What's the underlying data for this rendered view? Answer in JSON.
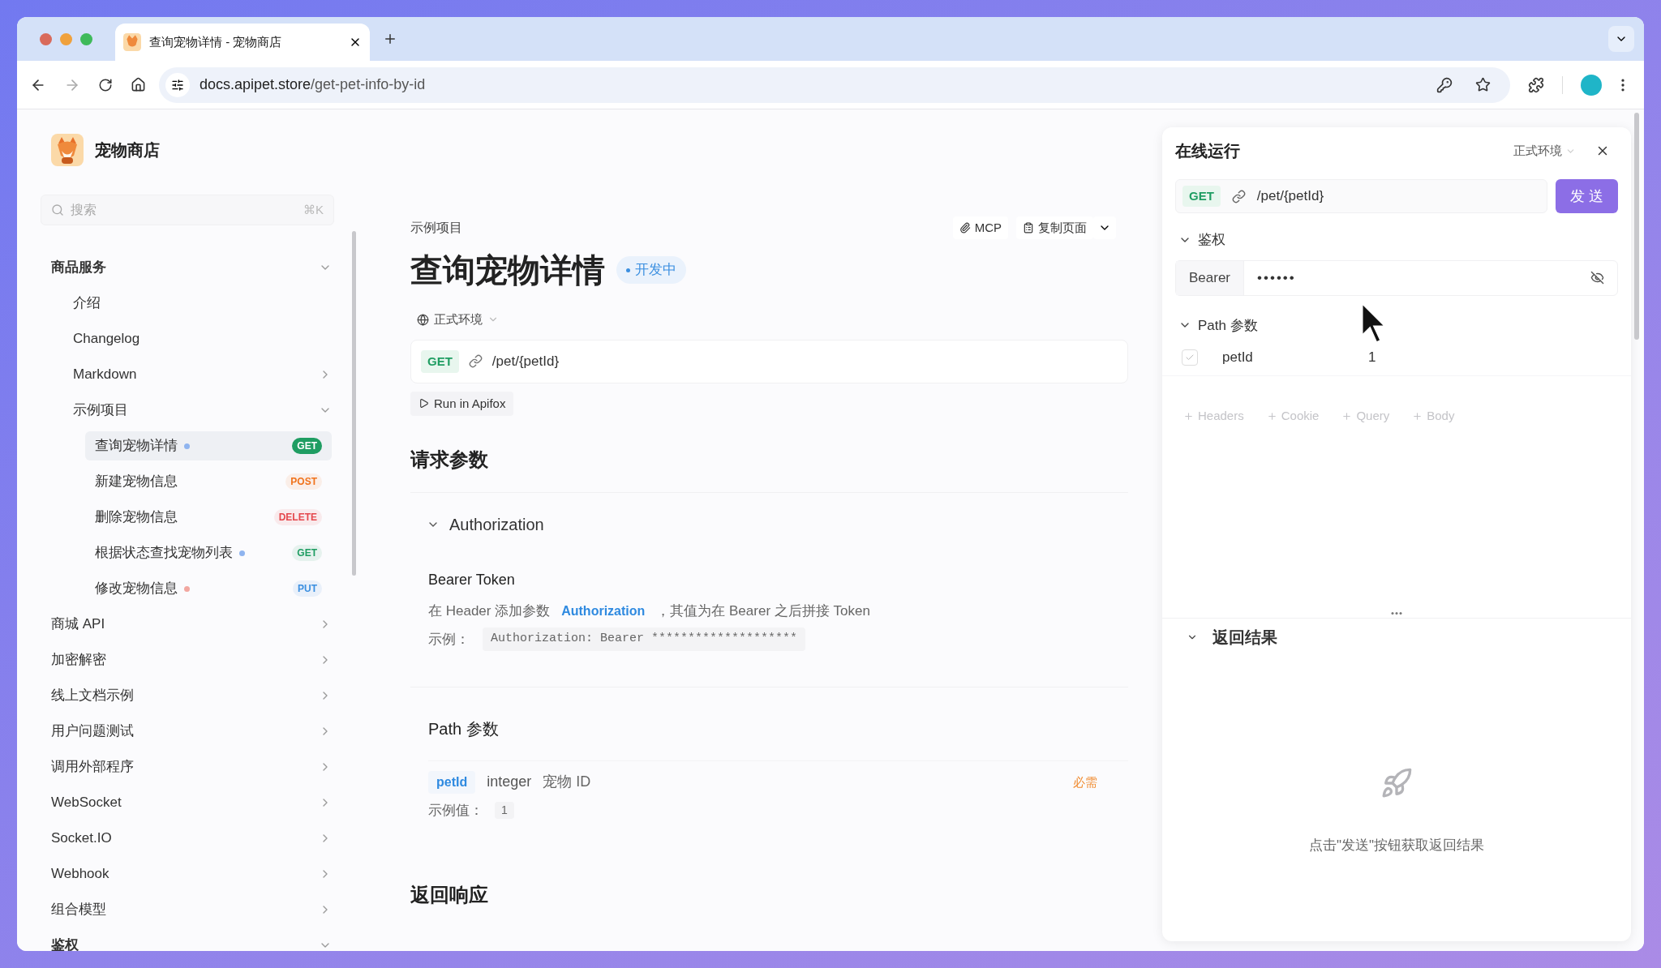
{
  "browser": {
    "tab_title": "查询宠物详情 - 宠物商店",
    "url_host": "docs.apipet.store",
    "url_path": "/get-pet-info-by-id"
  },
  "site": {
    "name": "宠物商店"
  },
  "search": {
    "placeholder": "搜索",
    "shortcut": "⌘K"
  },
  "sidebar": {
    "items": [
      {
        "kind": "folder",
        "label": "商品服务",
        "expanded": true,
        "children": [
          {
            "kind": "doc",
            "label": "介绍"
          },
          {
            "kind": "doc",
            "label": "Changelog"
          },
          {
            "kind": "folder",
            "label": "Markdown",
            "expanded": false
          },
          {
            "kind": "folder",
            "label": "示例项目",
            "expanded": true,
            "children": [
              {
                "kind": "endpoint",
                "label": "查询宠物详情",
                "color": "#8fb4ef",
                "badge": {
                  "method": "GET",
                  "color": "#1f9d62"
                },
                "selected": true
              },
              {
                "kind": "endpoint",
                "label": "新建宠物信息",
                "badge": {
                  "method": "POST",
                  "color": "#f0731d"
                },
                "selected": false
              },
              {
                "kind": "endpoint",
                "label": "删除宠物信息",
                "badge": {
                  "method": "DELETE",
                  "color": "#e5484d"
                },
                "selected": false
              },
              {
                "kind": "endpoint",
                "label": "根据状态查找宠物列表",
                "color": "#8fb4ef",
                "badge": {
                  "method": "GET",
                  "color": "#1f9d62"
                },
                "selected": false
              },
              {
                "kind": "endpoint",
                "label": "修改宠物信息",
                "color": "#f2a7a0",
                "badge": {
                  "method": "PUT",
                  "color": "#3b8fe0"
                },
                "selected": false
              }
            ]
          }
        ]
      },
      {
        "kind": "folder",
        "label": "商城 API",
        "expanded": false
      },
      {
        "kind": "folder",
        "label": "加密解密",
        "expanded": false
      },
      {
        "kind": "folder",
        "label": "线上文档示例",
        "expanded": false
      },
      {
        "kind": "folder",
        "label": "用户问题测试",
        "expanded": false
      },
      {
        "kind": "folder",
        "label": "调用外部程序",
        "expanded": false
      },
      {
        "kind": "folder",
        "label": "WebSocket",
        "expanded": false
      },
      {
        "kind": "folder",
        "label": "Socket.IO",
        "expanded": false
      },
      {
        "kind": "folder",
        "label": "Webhook",
        "expanded": false
      },
      {
        "kind": "folder",
        "label": "组合模型",
        "expanded": false
      },
      {
        "kind": "folder",
        "label": "鉴权",
        "expanded": true
      }
    ]
  },
  "page": {
    "breadcrumb": "示例项目",
    "actions": [
      {
        "kind": "mcp",
        "label": "MCP"
      },
      {
        "kind": "copy",
        "label": "复制页面"
      }
    ],
    "title": "查询宠物详情",
    "status": "开发中",
    "environment": "正式环境",
    "method": "GET",
    "path": "/pet/{petId}",
    "run_button": "Run in Apifox",
    "request_heading": "请求参数",
    "auth": {
      "heading": "Authorization",
      "expanded": true,
      "type": "Bearer Token",
      "text_before": "在 Header 添加参数",
      "highlight": "Authorization",
      "text_after": "，其值为在 Bearer 之后拼接 Token",
      "example_label": "示例：",
      "example": "Authorization: Bearer ********************"
    },
    "path_params": {
      "heading": "Path 参数",
      "params": [
        {
          "name": "petId",
          "type": "integer",
          "description": "宠物 ID",
          "required": "必需",
          "example_label": "示例值：",
          "example": "1"
        }
      ]
    },
    "response_heading": "返回响应"
  },
  "run_panel": {
    "title": "在线运行",
    "environment": "正式环境",
    "method": "GET",
    "path": "/pet/{petId}",
    "send": "发 送",
    "auth": {
      "heading": "鉴权",
      "expanded": true,
      "type": "Bearer",
      "value": "••••••"
    },
    "path_params": {
      "heading": "Path 参数",
      "expanded": true,
      "rows": [
        {
          "checked": true,
          "name": "petId",
          "value": "1"
        }
      ]
    },
    "add_buttons": [
      "Headers",
      "Cookie",
      "Query",
      "Body"
    ],
    "response": {
      "heading": "返回结果",
      "expanded": true,
      "empty_text": "点击\"发送\"按钮获取返回结果"
    }
  }
}
